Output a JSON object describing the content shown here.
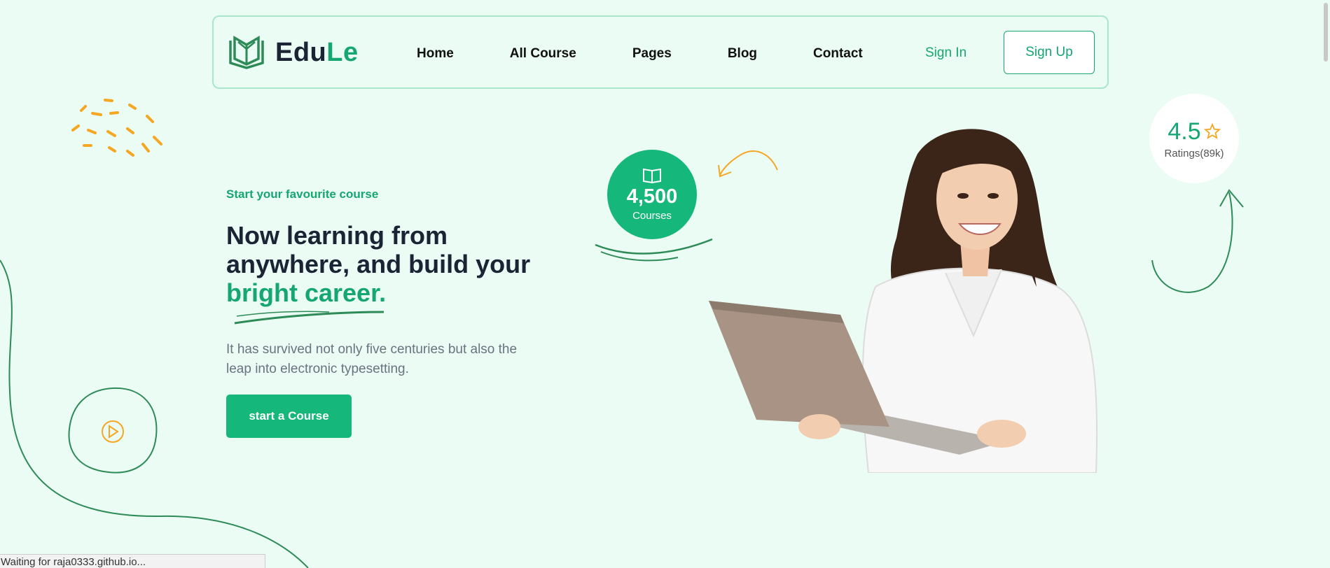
{
  "brand": {
    "name_main": "Edu",
    "name_accent": "Le",
    "logo_icon": "open-book-icon"
  },
  "nav": {
    "links": [
      "Home",
      "All Course",
      "Pages",
      "Blog",
      "Contact"
    ],
    "sign_in": "Sign In",
    "sign_up": "Sign Up"
  },
  "hero": {
    "eyebrow": "Start your favourite course",
    "headline_line1": "Now learning from",
    "headline_line2": "anywhere, and build your",
    "headline_highlight": "bright career.",
    "description": "It has survived not only five centuries but also the leap into electronic typesetting.",
    "cta": "start a Course"
  },
  "courses_badge": {
    "icon": "book-icon",
    "count": "4,500",
    "label": "Courses"
  },
  "rating": {
    "value": "4.5",
    "icon": "star-icon",
    "label": "Ratings(89k)"
  },
  "play": {
    "icon": "play-icon"
  },
  "status_bar": {
    "text": "Waiting for raja0333.github.io..."
  },
  "colors": {
    "background": "#eafcf3",
    "accent": "#16a672",
    "button": "#16b77a",
    "dark": "#1b2435",
    "orange": "#f5a623"
  }
}
